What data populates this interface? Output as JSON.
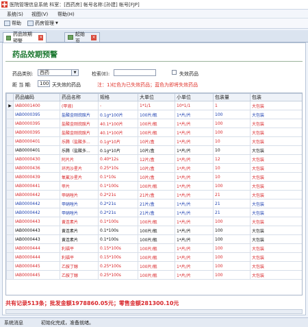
{
  "window": {
    "title": "医院管理信息系统 科室：[西药房] 帐号名称:[孙建] 帐号[FJP]"
  },
  "menu": [
    "系统(S)",
    "视图(V)",
    "帮助(H)"
  ],
  "toolbar": {
    "help_label": "帮助",
    "drug_mgmt_label": "药房管理"
  },
  "tabs": [
    {
      "label": "药品效期预警"
    },
    {
      "label": "起始页"
    }
  ],
  "heading": "药品效期预警",
  "filters": {
    "category_label": "药品类别:",
    "category_value": "西药",
    "search_label": "检索(E):",
    "search_value": "",
    "expired_label": "失效药品",
    "days_label": "距 当 期:",
    "days_value": "100",
    "days_suffix": "天失效的药品",
    "note": "注：1)红色为已失效药品；蓝色为即将失效药品"
  },
  "table": {
    "columns": [
      "药品编码",
      "药品名称",
      "规格",
      "大单位",
      "小单位",
      "包装量",
      "包装"
    ],
    "rows": [
      {
        "code": "IAB0001400",
        "name": "(甲液)",
        "spec": "-",
        "big": "1*1/1",
        "small": "10*1/1",
        "qty": "1",
        "pack": "大包装",
        "color": "red",
        "selected": true
      },
      {
        "code": "IAB0000395",
        "name": "盐酸金刚烷胺片",
        "spec": "0.1g*100片",
        "big": "100片/瓶",
        "small": "1*片/片",
        "qty": "100",
        "pack": "大包装",
        "color": "blue",
        "selected": false
      },
      {
        "code": "IAB0000395",
        "name": "盐酸金刚烷胺片",
        "spec": "40.1*100片",
        "big": "100片/瓶",
        "small": "1*片/片",
        "qty": "100",
        "pack": "大包装",
        "color": "red",
        "selected": false
      },
      {
        "code": "IAB0000395",
        "name": "盐酸金刚烷胺片",
        "spec": "40.1*100片",
        "big": "100片/瓶",
        "small": "1*片/片",
        "qty": "100",
        "pack": "大包装",
        "color": "red",
        "selected": false
      },
      {
        "code": "IAB0000401",
        "name": "乐腾（盐酸多...",
        "spec": "0.1g*10片",
        "big": "10片/盒",
        "small": "1*片/片",
        "qty": "10",
        "pack": "大包装",
        "color": "red",
        "selected": false
      },
      {
        "code": "IAB0000401",
        "name": "乐腾（盐酸多...",
        "spec": "0.1g*10片",
        "big": "10片/盒",
        "small": "1*片/片",
        "qty": "10",
        "pack": "大包装",
        "color": "black",
        "selected": false
      },
      {
        "code": "IAB0000430",
        "name": "阿片片",
        "spec": "0.40*12s",
        "big": "12片/盒",
        "small": "1*片/片",
        "qty": "12",
        "pack": "大包装",
        "color": "red",
        "selected": false
      },
      {
        "code": "IAB0000436",
        "name": "环丙沙星片",
        "spec": "0.25*10s",
        "big": "10片/盒",
        "small": "1*片/片",
        "qty": "10",
        "pack": "大包装",
        "color": "red",
        "selected": false
      },
      {
        "code": "IAB0000439",
        "name": "氧氟沙星片",
        "spec": "0.1*10s",
        "big": "10片/盒",
        "small": "1*片/片",
        "qty": "10",
        "pack": "大包装",
        "color": "red",
        "selected": false
      },
      {
        "code": "IAB0000441",
        "name": "甲片",
        "spec": "0.1*100s",
        "big": "100片/瓶",
        "small": "1*片/片",
        "qty": "100",
        "pack": "大包装",
        "color": "red",
        "selected": false
      },
      {
        "code": "IAB0000442",
        "name": "甲硝唑片",
        "spec": "0.2*21s",
        "big": "21片/盒",
        "small": "1*片/片",
        "qty": "21",
        "pack": "大包装",
        "color": "red",
        "selected": false
      },
      {
        "code": "IAB0000442",
        "name": "甲硝唑片",
        "spec": "0.2*21s",
        "big": "21片/盒",
        "small": "1*片/片",
        "qty": "21",
        "pack": "大包装",
        "color": "blue",
        "selected": false
      },
      {
        "code": "IAB0000442",
        "name": "甲硝唑片",
        "spec": "0.2*21s",
        "big": "21片/盒",
        "small": "1*片/片",
        "qty": "21",
        "pack": "大包装",
        "color": "blue",
        "selected": false
      },
      {
        "code": "IAB0000443",
        "name": "黄连素片",
        "spec": "0.1*100s",
        "big": "100片/瓶",
        "small": "1*片/片",
        "qty": "100",
        "pack": "大包装",
        "color": "red",
        "selected": false
      },
      {
        "code": "IAB0000443",
        "name": "黄连素片",
        "spec": "0.1*100s",
        "big": "100片/瓶",
        "small": "1*片/片",
        "qty": "100",
        "pack": "大包装",
        "color": "black",
        "selected": false
      },
      {
        "code": "IAB0000443",
        "name": "黄连素片",
        "spec": "0.1*100s",
        "big": "100片/瓶",
        "small": "1*片/片",
        "qty": "100",
        "pack": "大包装",
        "color": "black",
        "selected": false
      },
      {
        "code": "IAB0000444",
        "name": "利福平",
        "spec": "0.15*100s",
        "big": "100片/瓶",
        "small": "1*片/片",
        "qty": "100",
        "pack": "大包装",
        "color": "red",
        "selected": false
      },
      {
        "code": "IAB0000444",
        "name": "利福平",
        "spec": "0.15*100s",
        "big": "100片/瓶",
        "small": "1*片/片",
        "qty": "100",
        "pack": "大包装",
        "color": "red",
        "selected": false
      },
      {
        "code": "IAB0000445",
        "name": "乙胺丁醇",
        "spec": "0.25*100s",
        "big": "100片/瓶",
        "small": "1*片/片",
        "qty": "100",
        "pack": "大包装",
        "color": "red",
        "selected": false
      },
      {
        "code": "IAB0000445",
        "name": "乙胺丁醇",
        "spec": "0.25*100s",
        "big": "100片/瓶",
        "small": "1*片/片",
        "qty": "100",
        "pack": "大包装",
        "color": "red",
        "selected": false
      }
    ]
  },
  "summary": "共有记录513条；批发金额1978860.05元；零售金额281300.10元",
  "status": {
    "left": "系统消息",
    "right": "初始化完成，准备就绪。"
  }
}
